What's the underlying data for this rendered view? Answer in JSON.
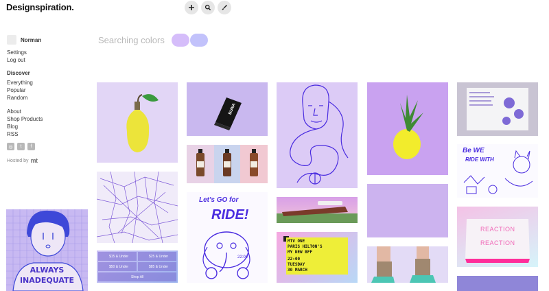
{
  "header": {
    "logo": "Designspiration."
  },
  "toolbar": {
    "add_icon": "plus-icon",
    "search_icon": "search-icon",
    "brush_icon": "brush-icon"
  },
  "sidebar": {
    "username": "Norman",
    "account_links": [
      "Settings",
      "Log out"
    ],
    "discover_title": "Discover",
    "discover_links": [
      "Everything",
      "Popular",
      "Random"
    ],
    "info_links": [
      "About",
      "Shop Products",
      "Blog",
      "RSS"
    ],
    "social_icons": [
      "instagram-icon",
      "twitter-icon",
      "facebook-icon"
    ],
    "hosted_by": "Hosted by",
    "hosted_logo": "mt"
  },
  "promo": {
    "line1": "ALWAYS",
    "line2": "INADEQUATE"
  },
  "search": {
    "label": "Searching colors",
    "colors": [
      "#d5bdfa",
      "#c2c2fb"
    ]
  },
  "tiles": {
    "bottle_box": "BUNA",
    "price_tags": [
      "$15 & Under",
      "$25 & Under",
      "$50 & Under",
      "$85 & Under"
    ],
    "shop_all": "Shop All",
    "ride_text1": "Let's GO for",
    "ride_text2": "RIDE!",
    "ride_time": "22:00",
    "mtv_lines": [
      "MTV ONE",
      "PARIS HILTON'S",
      "MY NEW BFF",
      "22:00",
      "TUESDAY",
      "30 MARCH"
    ],
    "doodle_text1": "Be WE",
    "doodle_text2": "RIDE WITH",
    "reaction": [
      "REACTION",
      "REACTION"
    ]
  },
  "colors": {
    "accent": "#5b3fd6",
    "lavender": "#d8c6f7",
    "tile_bg": "#e7dcf8"
  }
}
